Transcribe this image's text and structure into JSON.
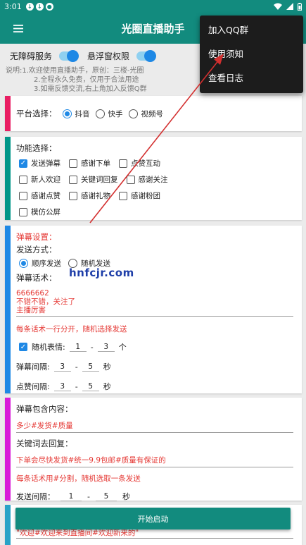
{
  "status_bar": {
    "time": "3:01"
  },
  "app_bar": {
    "title": "光圈直播助手"
  },
  "menu": {
    "items": [
      "加入QQ群",
      "使用须知",
      "查看日志"
    ]
  },
  "toggles": {
    "accessibility": "无障碍服务",
    "floating": "悬浮窗权限"
  },
  "notice": {
    "lines": [
      "说明:1.欢迎使用直播助手，原创：三楼-光圈",
      "2.全程永久免费，仅用于合法用途",
      "3.如需反馈交流,右上角加入反馈Q群"
    ]
  },
  "platform": {
    "label": "平台选择：",
    "options": [
      "抖音",
      "快手",
      "视频号"
    ],
    "selected": "抖音"
  },
  "features": {
    "label": "功能选择：",
    "items": [
      {
        "label": "发送弹幕",
        "checked": true
      },
      {
        "label": "感谢下单",
        "checked": false
      },
      {
        "label": "点赞互动",
        "checked": false
      },
      {
        "label": "新人欢迎",
        "checked": false
      },
      {
        "label": "关键词回复",
        "checked": false
      },
      {
        "label": "感谢关注",
        "checked": false
      },
      {
        "label": "感谢点赞",
        "checked": false
      },
      {
        "label": "感谢礼物",
        "checked": false
      },
      {
        "label": "感谢粉团",
        "checked": false
      },
      {
        "label": "模仿公屏",
        "checked": false
      }
    ]
  },
  "danmu": {
    "title": "弹幕设置：",
    "send_mode_label": "发送方式：",
    "modes": [
      "顺序发送",
      "随机发送"
    ],
    "selected_mode": "顺序发送",
    "script_label": "弹幕话术：",
    "script_lines": [
      "6666662",
      "不错不错，关注了",
      "主播厉害"
    ],
    "hint": "每条话术一行分开，随机选择发送",
    "emoji_label": "随机表情:",
    "emoji_min": "1",
    "emoji_max": "3",
    "emoji_unit": "个",
    "interval_label": "弹幕间隔:",
    "interval_min": "3",
    "interval_max": "5",
    "interval_unit": "秒",
    "like_label": "点赞间隔:",
    "like_min": "3",
    "like_max": "5",
    "like_unit": "秒",
    "dash": "-"
  },
  "keyword": {
    "contains_label": "弹幕包含内容：",
    "contains_value": "多少#发货#质量",
    "reply_label": "关键词去回复：",
    "reply_value": "下单会尽快发货#统一9.9包邮#质量有保证的",
    "hint": "每条话术用#分割，随机选取一条发送",
    "interval_label": "发送间隔：",
    "interval_min": "1",
    "interval_max": "5",
    "interval_unit": "秒"
  },
  "welcome": {
    "value": "\"欢迎#欢迎来到直播间#欢迎新来的\""
  },
  "start_button": "开始启动",
  "watermark": "hnfcjr.com",
  "colors": {
    "primary": "#128b7e",
    "accent": "#1e88e5",
    "bar_platform": "#e91e63",
    "bar_features": "#009688",
    "bar_danmu": "#1e88e5",
    "bar_keyword": "#d81bd8",
    "bar_welcome": "#29a3c7",
    "hint_red": "#e53935"
  }
}
